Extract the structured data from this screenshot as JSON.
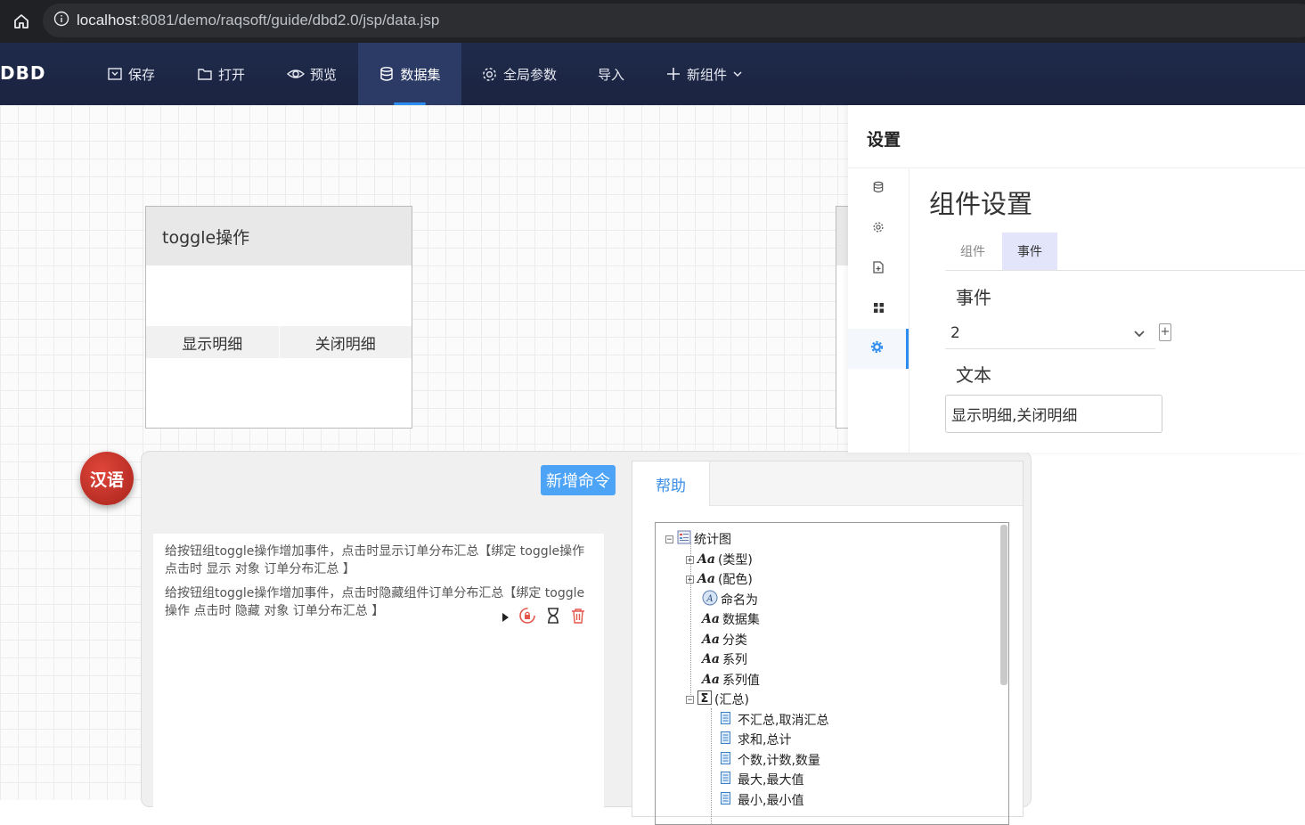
{
  "browser": {
    "url_host": "localhost",
    "url_path": ":8081/demo/raqsoft/guide/dbd2.0/jsp/data.jsp"
  },
  "nav": {
    "brand": "DBD",
    "items": [
      {
        "label": "保存",
        "icon": "save-icon"
      },
      {
        "label": "打开",
        "icon": "folder-open-icon"
      },
      {
        "label": "预览",
        "icon": "eye-icon"
      },
      {
        "label": "数据集",
        "icon": "database-icon",
        "active": true
      },
      {
        "label": "全局参数",
        "icon": "gear-icon"
      },
      {
        "label": "导入",
        "icon": ""
      },
      {
        "label": "新组件",
        "icon": "plus-icon",
        "dropdown": true
      }
    ]
  },
  "canvas": {
    "widget_title": "toggle操作",
    "toggle_buttons": [
      "显示明细",
      "关闭明细"
    ]
  },
  "lang_badge": "汉语",
  "commands": {
    "add_button": "新增命令",
    "items": [
      "给按钮组toggle操作增加事件，点击时显示订单分布汇总【绑定 toggle操作 点击时 显示 对象 订单分布汇总 】",
      "给按钮组toggle操作增加事件，点击时隐藏组件订单分布汇总【绑定 toggle操作 点击时 隐藏 对象 订单分布汇总 】"
    ]
  },
  "help": {
    "tab": "帮助",
    "tree": [
      {
        "label": "统计图",
        "toggle": "-",
        "icon": "chart-icon",
        "level": 0
      },
      {
        "label": "(类型)",
        "toggle": "+",
        "icon": "aa-icon",
        "level": 1
      },
      {
        "label": "(配色)",
        "toggle": "+",
        "icon": "aa-icon",
        "level": 1
      },
      {
        "label": "命名为",
        "toggle": "",
        "icon": "rename-icon",
        "level": 1
      },
      {
        "label": "数据集",
        "toggle": "",
        "icon": "aa-icon",
        "level": 1
      },
      {
        "label": "分类",
        "toggle": "",
        "icon": "aa-icon",
        "level": 1
      },
      {
        "label": "系列",
        "toggle": "",
        "icon": "aa-icon",
        "level": 1
      },
      {
        "label": "系列值",
        "toggle": "",
        "icon": "aa-icon",
        "level": 1
      },
      {
        "label": "(汇总)",
        "toggle": "-",
        "icon": "sigma-icon",
        "level": 1
      },
      {
        "label": "不汇总,取消汇总",
        "toggle": "",
        "icon": "doc-icon",
        "level": 2
      },
      {
        "label": "求和,总计",
        "toggle": "",
        "icon": "doc-icon",
        "level": 2
      },
      {
        "label": "个数,计数,数量",
        "toggle": "",
        "icon": "doc-icon",
        "level": 2
      },
      {
        "label": "最大,最大值",
        "toggle": "",
        "icon": "doc-icon",
        "level": 2
      },
      {
        "label": "最小,最小值",
        "toggle": "",
        "icon": "doc-icon",
        "level": 2
      }
    ]
  },
  "settings": {
    "title": "设置",
    "main_title": "组件设置",
    "tabs": [
      {
        "label": "组件"
      },
      {
        "label": "事件",
        "active": true
      }
    ],
    "event_label": "事件",
    "event_value": "2",
    "plus": "+",
    "text_label": "文本",
    "text_value": "显示明细,关闭明细"
  },
  "colors": {
    "nav_bg": "#1f2a4b",
    "accent": "#2d8cf0",
    "add_button": "#4da3f6",
    "badge": "#c4302b"
  }
}
